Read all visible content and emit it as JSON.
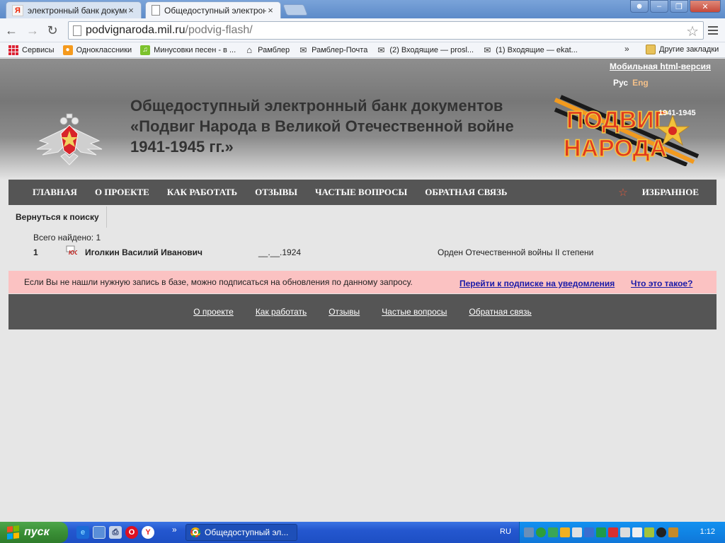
{
  "browser": {
    "tabs": [
      {
        "title": "электронный банк докуме",
        "active": false
      },
      {
        "title": "Общедоступный электрон",
        "active": true
      }
    ],
    "url_host": "podvignaroda.mil.ru",
    "url_path": "/podvig-flash/",
    "bookmarks": [
      {
        "label": "Сервисы",
        "icon": "apps-grid-icon"
      },
      {
        "label": "Одноклассники",
        "icon": "odnoklassniki-icon"
      },
      {
        "label": "Минусовки песен - в ...",
        "icon": "music-icon"
      },
      {
        "label": "Рамблер",
        "icon": "house-icon"
      },
      {
        "label": "Рамблер-Почта",
        "icon": "mail-icon"
      },
      {
        "label": "(2) Входящие — prosl...",
        "icon": "mail-icon"
      },
      {
        "label": "(1) Входящие — ekat...",
        "icon": "mail-icon"
      }
    ],
    "bookmarks_more": "»",
    "other_bookmarks": "Другие закладки"
  },
  "site": {
    "mobile_link": "Мобильная html-версия",
    "lang_ru": "Рус",
    "lang_en": "Eng",
    "title": "Общедоступный электронный банк документов «Подвиг Народа в Великой Отечественной войне 1941-1945 гг.»",
    "logo_years": "1941-1945",
    "logo_text_1": "ПОДВИГ",
    "logo_text_2": "НАРОДА",
    "nav": [
      "ГЛАВНАЯ",
      "О ПРОЕКТЕ",
      "КАК РАБОТАТЬ",
      "ОТЗЫВЫ",
      "ЧАСТЫЕ ВОПРОСЫ",
      "ОБРАТНАЯ СВЯЗЬ"
    ],
    "favorites": "ИЗБРАННОЕ"
  },
  "results": {
    "back": "Вернуться к поиску",
    "found": "Всего найдено: 1",
    "rows": [
      {
        "num": "1",
        "name": "Иголкин Василий Иванович",
        "date": "__.__.1924",
        "award": "Орден Отечественной войны II степени"
      }
    ]
  },
  "subscribe": {
    "text": "Если Вы не нашли нужную запись в базе, можно подписаться на обновления по данному запросу.",
    "link": "Перейти к подписке на уведомления",
    "what": "Что это такое?"
  },
  "footer": [
    "О проекте",
    "Как работать",
    "Отзывы",
    "Частые вопросы",
    "Обратная связь"
  ],
  "taskbar": {
    "start": "пуск",
    "overflow": "»",
    "task": "Общедоступный эл...",
    "lang": "RU",
    "clock": "1:12"
  },
  "colors": {
    "nav_bg": "#555555",
    "subscribe_bg": "#fbc2c2",
    "link": "#1a1aa8",
    "taskbar": "#2457cf",
    "start": "#3a8f36"
  }
}
